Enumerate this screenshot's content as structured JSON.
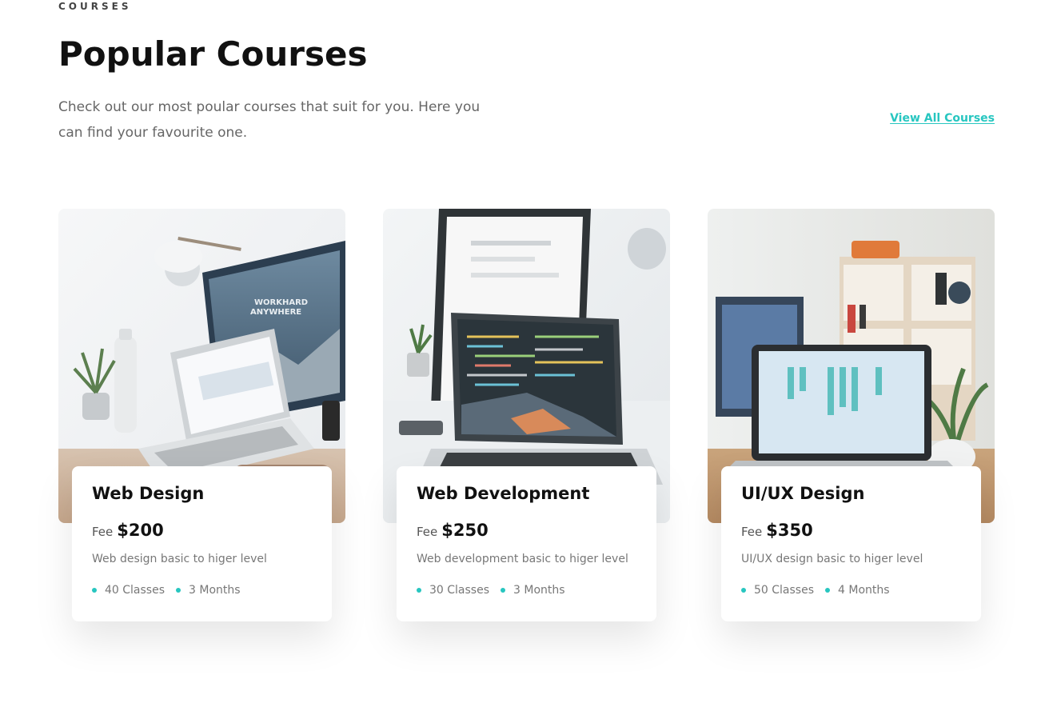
{
  "header": {
    "eyebrow": "COURSES",
    "title": "Popular Courses",
    "description": "Check out our most poular courses that suit for you. Here you can find your favourite one.",
    "view_all_label": "View All Courses"
  },
  "theme": {
    "accent": "#27c6c0",
    "text": "#111111",
    "muted": "#777777"
  },
  "courses": [
    {
      "name": "Web Design",
      "fee_label": "Fee",
      "fee_value": "$200",
      "description": "Web design basic to higer level",
      "classes": "40 Classes",
      "duration": "3 Months",
      "photo_icon": "laptop-desk-photo"
    },
    {
      "name": "Web Development",
      "fee_label": "Fee",
      "fee_value": "$250",
      "description": "Web development basic to higer level",
      "classes": "30 Classes",
      "duration": "3 Months",
      "photo_icon": "code-laptop-photo"
    },
    {
      "name": "UI/UX Design",
      "fee_label": "Fee",
      "fee_value": "$350",
      "description": "UI/UX design basic to higer level",
      "classes": "50 Classes",
      "duration": "4 Months",
      "photo_icon": "design-laptop-photo"
    }
  ]
}
